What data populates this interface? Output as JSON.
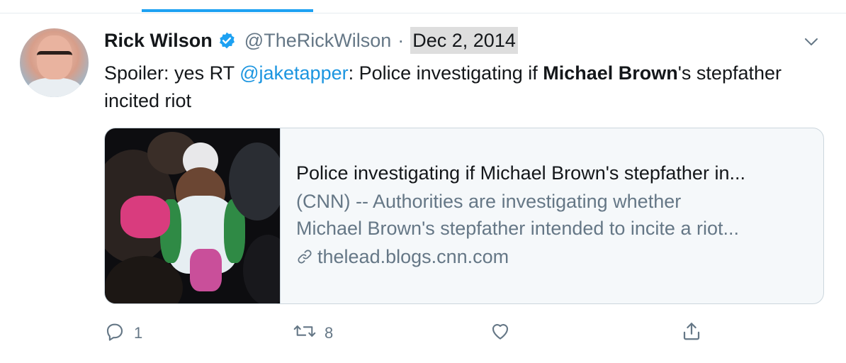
{
  "tweet": {
    "author": {
      "display_name": "Rick Wilson",
      "handle": "@TheRickWilson",
      "verified": true
    },
    "separator": "·",
    "date": "Dec 2, 2014",
    "text": {
      "prefix": "Spoiler: yes RT ",
      "mention": "@jaketapper",
      "middle": ": Police investigating if ",
      "bold": "Michael Brown",
      "suffix": "'s stepfather incited riot"
    },
    "card": {
      "title": "Police investigating if Michael Brown's stepfather in...",
      "description_line1": "(CNN) -- Authorities are investigating whether",
      "description_line2": "Michael Brown's stepfather intended to incite a riot...",
      "domain": "thelead.blogs.cnn.com"
    },
    "actions": {
      "reply_count": "1",
      "retweet_count": "8",
      "like_count": "",
      "share_count": ""
    }
  },
  "colors": {
    "accent": "#1da1f2",
    "mention": "#1b95e0",
    "secondary_text": "#657786"
  },
  "icons": {
    "verified": "verified-badge-icon",
    "caret": "chevron-down-icon",
    "link": "link-icon",
    "reply": "reply-icon",
    "retweet": "retweet-icon",
    "like": "heart-icon",
    "share": "share-icon"
  }
}
